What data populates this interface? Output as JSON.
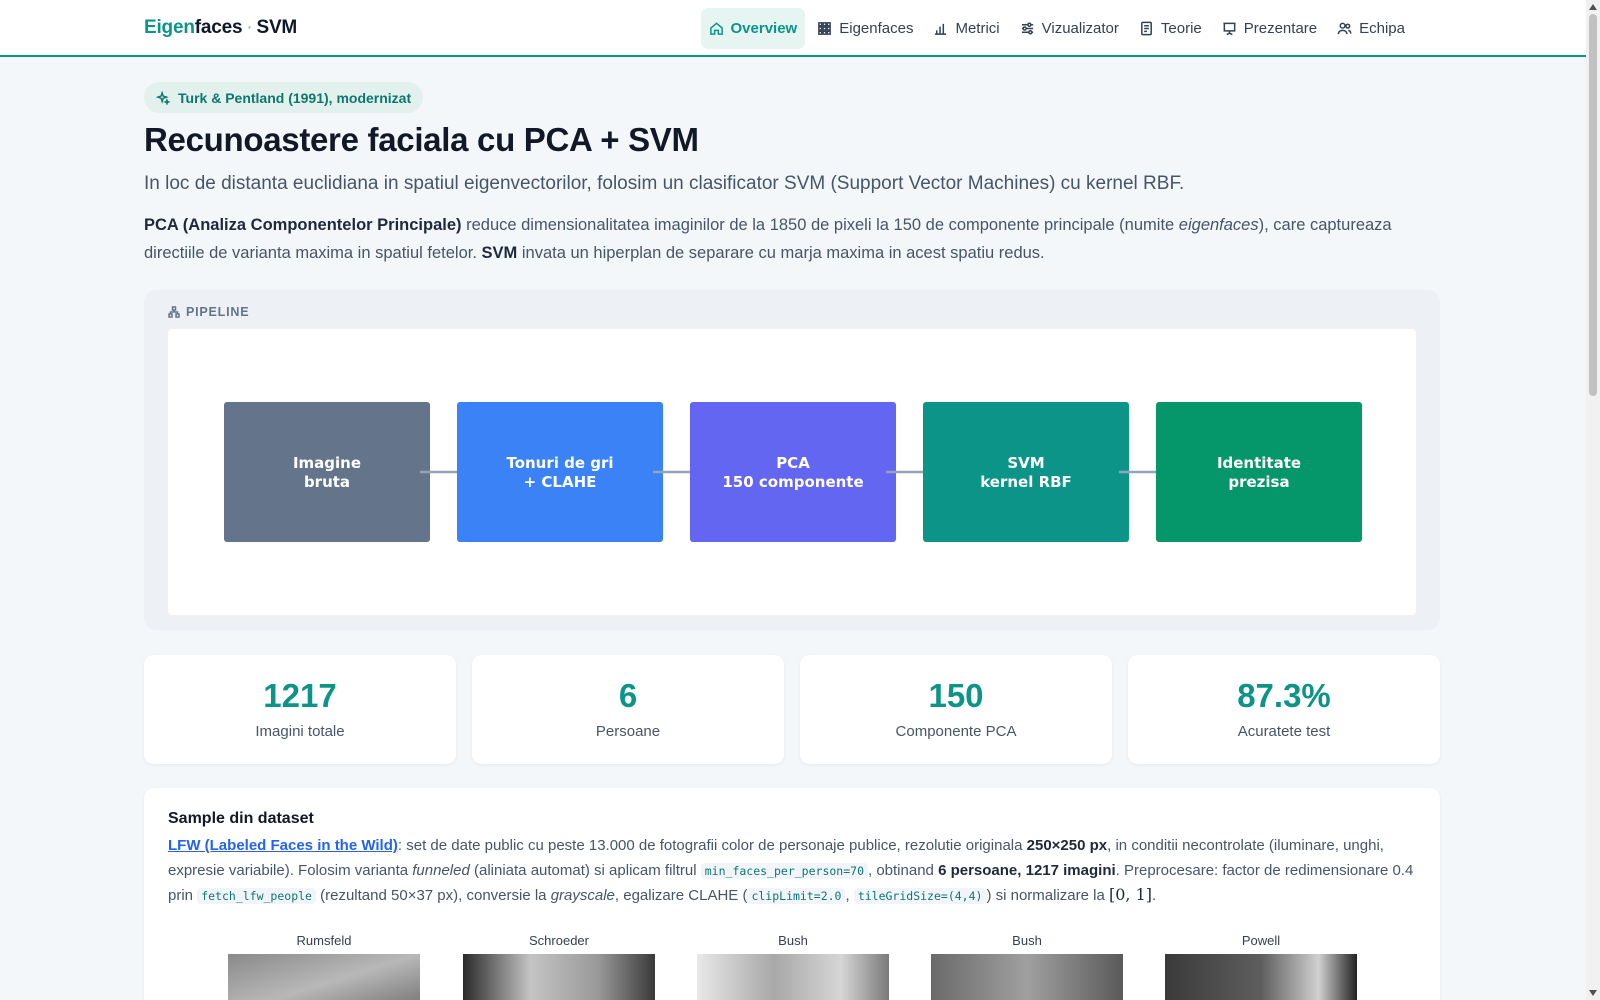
{
  "brand": {
    "part1": "Eigen",
    "part2": "faces",
    "sep": "·",
    "part3": "SVM"
  },
  "nav": [
    {
      "label": "Overview",
      "icon": "home-icon",
      "active": true
    },
    {
      "label": "Eigenfaces",
      "icon": "grid-icon",
      "active": false
    },
    {
      "label": "Metrici",
      "icon": "bar-chart-icon",
      "active": false
    },
    {
      "label": "Vizualizator",
      "icon": "sliders-icon",
      "active": false
    },
    {
      "label": "Teorie",
      "icon": "document-icon",
      "active": false
    },
    {
      "label": "Prezentare",
      "icon": "presentation-icon",
      "active": false
    },
    {
      "label": "Echipa",
      "icon": "users-icon",
      "active": false
    }
  ],
  "hero": {
    "badge": "Turk & Pentland (1991), modernizat",
    "title": "Recunoastere faciala cu PCA + SVM",
    "subtitle": "In loc de distanta euclidiana in spatiul eigenvectorilor, folosim un clasificator SVM (Support Vector Machines) cu kernel RBF.",
    "intro_b1": "PCA (Analiza Componentelor Principale)",
    "intro_t1": " reduce dimensionalitatea imaginilor de la 1850 de pixeli la 150 de componente principale (numite ",
    "intro_i1": "eigenfaces",
    "intro_t2": "), care captureaza directiile de varianta maxima in spatiul fetelor. ",
    "intro_b2": "SVM",
    "intro_t3": " invata un hiperplan de separare cu marja maxima in acest spatiu redus."
  },
  "pipeline": {
    "label": "PIPELINE",
    "steps": [
      {
        "line1": "Imagine",
        "line2": "bruta",
        "color": "#64748b"
      },
      {
        "line1": "Tonuri de gri",
        "line2": "+ CLAHE",
        "color": "#3b82f6"
      },
      {
        "line1": "PCA",
        "line2": "150 componente",
        "color": "#6366f1"
      },
      {
        "line1": "SVM",
        "line2": "kernel RBF",
        "color": "#0d9488"
      },
      {
        "line1": "Identitate",
        "line2": "prezisa",
        "color": "#059669"
      }
    ],
    "arrow_color": "#94a3b8"
  },
  "stats": [
    {
      "value": "1217",
      "label": "Imagini totale"
    },
    {
      "value": "6",
      "label": "Persoane"
    },
    {
      "value": "150",
      "label": "Componente PCA"
    },
    {
      "value": "87.3%",
      "label": "Acuratete test"
    }
  ],
  "dataset": {
    "title": "Sample din dataset",
    "link": "LFW (Labeled Faces in the Wild)",
    "t1": ": set de date public cu peste 13.000 de fotografii color de personaje publice, rezolutie originala ",
    "b1": "250×250 px",
    "t2": ", in conditii necontrolate (iluminare, unghi, expresie variabile). Folosim varianta ",
    "i1": "funneled",
    "t3": " (aliniata automat) si aplicam filtrul ",
    "c1": "min_faces_per_person=70",
    "t4": ", obtinand ",
    "b2": "6 persoane, 1217 imagini",
    "t5": ". Preprocesare: factor de redimensionare 0.4 prin ",
    "c2": "fetch_lfw_people",
    "t6": " (rezultand 50×37 px), conversie la ",
    "i2": "grayscale",
    "t7": ", egalizare CLAHE (",
    "c3": "clipLimit=2.0",
    "t8": ", ",
    "c4": "tileGridSize=(4,4)",
    "t9": ") si normalizare la ",
    "m1": "[0, 1]",
    "t10": "."
  },
  "samples": [
    {
      "name": "Rumsfeld"
    },
    {
      "name": "Schroeder"
    },
    {
      "name": "Bush"
    },
    {
      "name": "Bush"
    },
    {
      "name": "Powell"
    }
  ],
  "colors": {
    "accent": "#0d9488",
    "link": "#2563eb"
  }
}
